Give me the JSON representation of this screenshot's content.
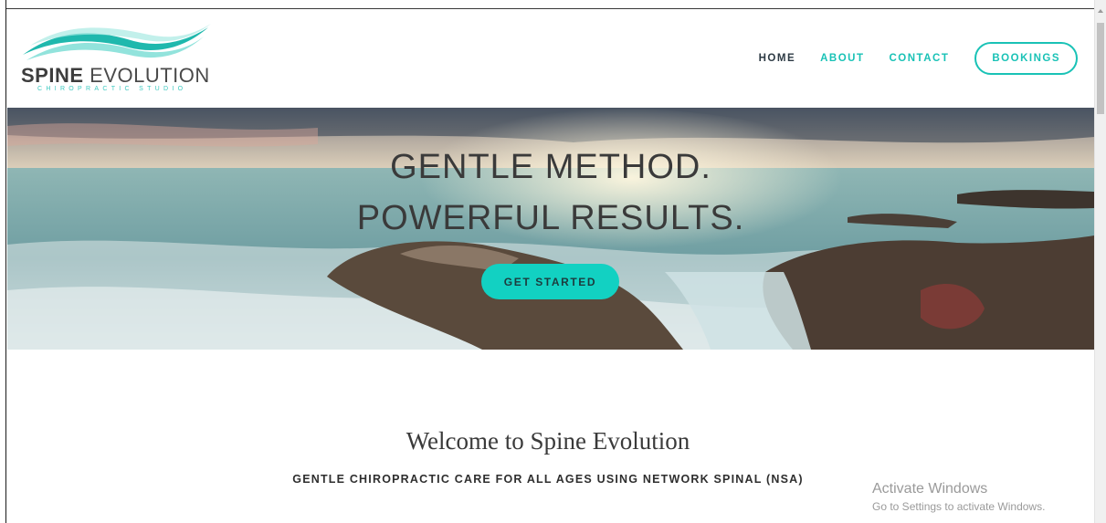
{
  "logo": {
    "brand_bold": "SPINE",
    "brand_light": "EVOLUTION",
    "tagline": "CHIROPRACTIC STUDIO"
  },
  "nav": {
    "items": [
      {
        "label": "HOME",
        "active": true
      },
      {
        "label": "ABOUT",
        "active": false
      },
      {
        "label": "CONTACT",
        "active": false
      }
    ],
    "bookings_label": "BOOKINGS"
  },
  "hero": {
    "line1": "GENTLE METHOD.",
    "line2": "POWERFUL RESULTS.",
    "cta_label": "GET STARTED"
  },
  "welcome": {
    "title": "Welcome to Spine Evolution",
    "subtitle": "GENTLE CHIROPRACTIC CARE FOR ALL AGES USING NETWORK SPINAL (NSA)"
  },
  "windows_watermark": {
    "title": "Activate Windows",
    "message": "Go to Settings to activate Windows."
  },
  "colors": {
    "accent": "#19c2b6",
    "cta": "#12d1c2",
    "text_dark": "#2d3a44"
  }
}
